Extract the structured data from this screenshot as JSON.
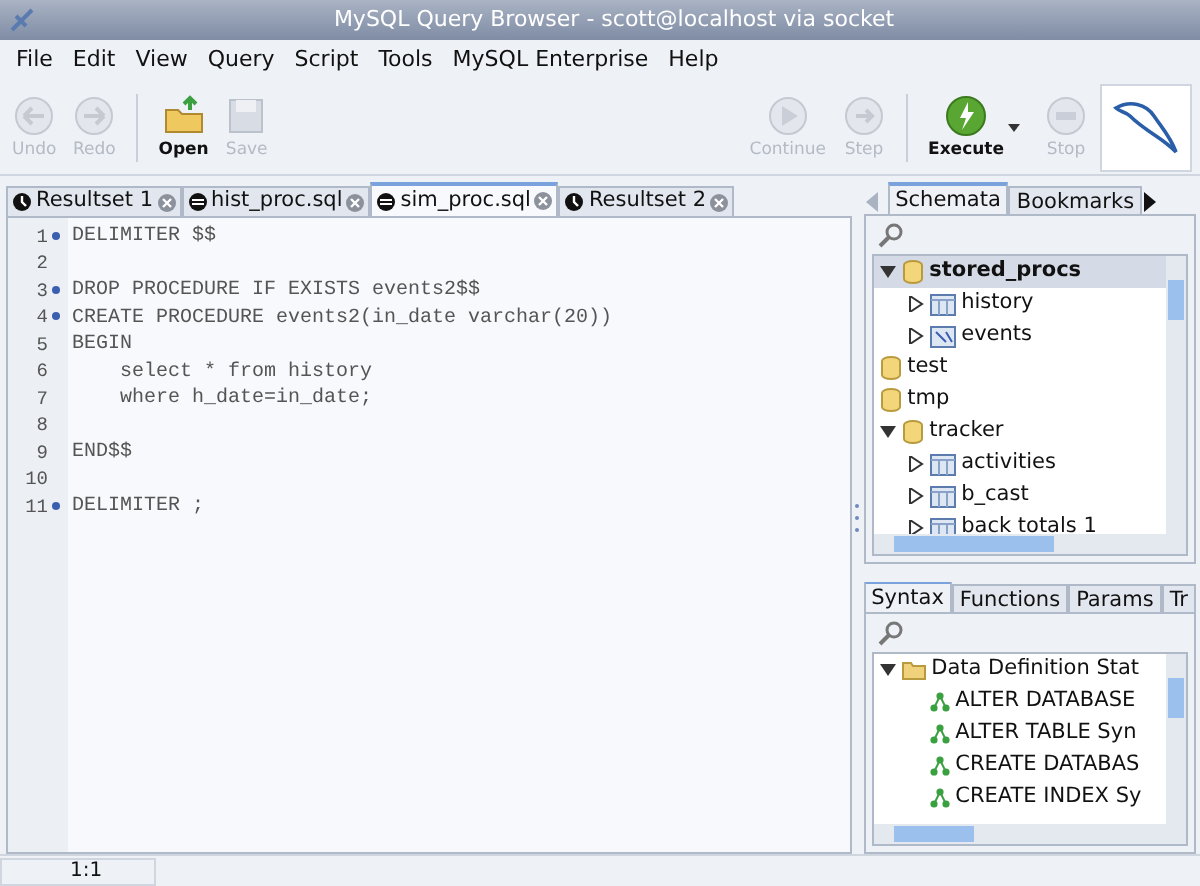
{
  "window": {
    "title": "MySQL Query Browser - scott@localhost via socket"
  },
  "menu": [
    "File",
    "Edit",
    "View",
    "Query",
    "Script",
    "Tools",
    "MySQL Enterprise",
    "Help"
  ],
  "toolbar": [
    {
      "kind": "undo",
      "label": "Undo",
      "disabled": true
    },
    {
      "kind": "redo",
      "label": "Redo",
      "disabled": true
    },
    {
      "kind": "open",
      "label": "Open",
      "disabled": false
    },
    {
      "kind": "save",
      "label": "Save",
      "disabled": true
    },
    {
      "kind": "continue",
      "label": "Continue",
      "disabled": true
    },
    {
      "kind": "step",
      "label": "Step",
      "disabled": true
    },
    {
      "kind": "execute",
      "label": "Execute",
      "disabled": false
    },
    {
      "kind": "stop",
      "label": "Stop",
      "disabled": true
    }
  ],
  "editor_tabs": [
    {
      "kind": "result",
      "label": "Resultset 1",
      "selected": false
    },
    {
      "kind": "script",
      "label": "hist_proc.sql",
      "selected": false
    },
    {
      "kind": "script",
      "label": "sim_proc.sql",
      "selected": true
    },
    {
      "kind": "result",
      "label": "Resultset 2",
      "selected": false
    }
  ],
  "editor": {
    "lines": [
      {
        "number": "1",
        "text": "DELIMITER $$",
        "marked": true
      },
      {
        "number": "2",
        "marked": false
      },
      {
        "number": "3",
        "text": "DROP PROCEDURE IF EXISTS events2$$",
        "marked": true
      },
      {
        "number": "4",
        "text": "CREATE PROCEDURE events2(in_date varchar(20))",
        "marked": true
      },
      {
        "number": "5",
        "text": "BEGIN",
        "marked": false
      },
      {
        "number": "6",
        "text": "    select * from history",
        "marked": false
      },
      {
        "number": "7",
        "text": "    where h_date=in_date;",
        "marked": false
      },
      {
        "number": "8",
        "marked": false
      },
      {
        "number": "9",
        "text": "END$$",
        "marked": false
      },
      {
        "number": "10",
        "marked": false
      },
      {
        "number": "11",
        "text": "DELIMITER ;",
        "marked": true
      }
    ]
  },
  "browser_tabs": [
    {
      "label": "Schemata",
      "selected": true
    },
    {
      "label": "Bookmarks",
      "selected": false
    }
  ],
  "schema_tree": [
    {
      "kind": "schema",
      "label": "stored_procs",
      "expanded": true,
      "selected": true,
      "children": [
        {
          "kind": "table",
          "label": "history",
          "expanded": false,
          "selected": false
        },
        {
          "kind": "view",
          "label": "events",
          "expanded": false,
          "selected": false
        }
      ]
    },
    {
      "kind": "schema",
      "label": "test",
      "selected": false
    },
    {
      "kind": "schema",
      "label": "tmp",
      "selected": false
    },
    {
      "kind": "schema",
      "label": "tracker",
      "expanded": true,
      "selected": false,
      "children": [
        {
          "kind": "table",
          "label": "activities",
          "expanded": false,
          "selected": false
        },
        {
          "kind": "table",
          "label": "b_cast",
          "expanded": false,
          "selected": false
        },
        {
          "kind": "table",
          "label": "back totals 1",
          "expanded": false,
          "selected": false
        }
      ]
    }
  ],
  "help_tabs": [
    {
      "label": "Syntax",
      "selected": true
    },
    {
      "label": "Functions",
      "selected": false
    },
    {
      "label": "Params",
      "selected": false
    },
    {
      "label": "Tr",
      "selected": false
    }
  ],
  "syntax_tree": [
    {
      "kind": "folder",
      "label": "Data Definition Stat",
      "expanded": true,
      "children": [
        {
          "kind": "topic",
          "label": "ALTER DATABASE"
        },
        {
          "kind": "topic",
          "label": "ALTER TABLE Syn"
        },
        {
          "kind": "topic",
          "label": "CREATE DATABAS"
        },
        {
          "kind": "topic",
          "label": "CREATE INDEX Sy"
        }
      ]
    }
  ],
  "status_bar": {
    "position": "1:1"
  }
}
